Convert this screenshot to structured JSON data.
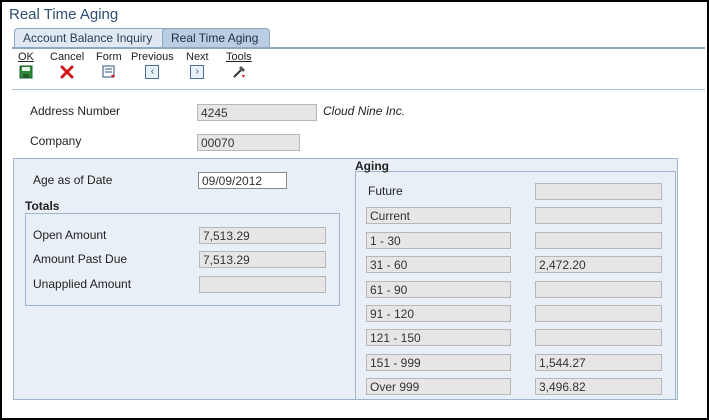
{
  "window": {
    "title": "Real Time Aging"
  },
  "tabs": [
    {
      "label": "Account Balance Inquiry"
    },
    {
      "label": "Real Time Aging"
    }
  ],
  "toolbar": {
    "ok": "OK",
    "cancel": "Cancel",
    "form": "Form",
    "previous": "Previous",
    "next": "Next",
    "tools": "Tools",
    "previous_glyph": "‹",
    "next_glyph": "›"
  },
  "header": {
    "address_number_label": "Address Number",
    "address_number_value": "4245",
    "address_name": "Cloud Nine Inc.",
    "company_label": "Company",
    "company_value": "00070"
  },
  "age_as_of": {
    "label": "Age as of Date",
    "value": "09/09/2012"
  },
  "totals": {
    "title": "Totals",
    "open_amount_label": "Open Amount",
    "open_amount_value": "7,513.29",
    "past_due_label": "Amount Past Due",
    "past_due_value": "7,513.29",
    "unapplied_label": "Unapplied Amount",
    "unapplied_value": ""
  },
  "aging": {
    "title": "Aging",
    "future_label": "Future",
    "future_value": "",
    "rows": [
      {
        "label": "Current",
        "value": ""
      },
      {
        "label": "1 - 30",
        "value": ""
      },
      {
        "label": "31 - 60",
        "value": "2,472.20"
      },
      {
        "label": "61 - 90",
        "value": ""
      },
      {
        "label": "91 - 120",
        "value": ""
      },
      {
        "label": "121 - 150",
        "value": ""
      },
      {
        "label": "151 - 999",
        "value": "1,544.27"
      },
      {
        "label": "Over 999",
        "value": "3,496.82"
      }
    ]
  },
  "colors": {
    "title": "#2e4e72",
    "panel": "#e9eff6",
    "cancel_red": "#d0161c"
  }
}
